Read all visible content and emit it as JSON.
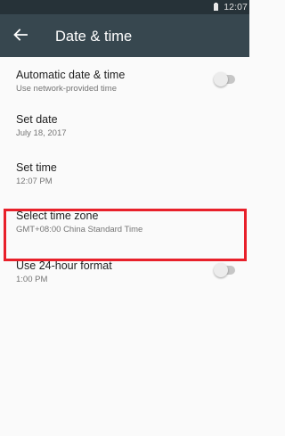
{
  "status_bar": {
    "time": "12:07"
  },
  "app_bar": {
    "back_icon": "arrow-left-icon",
    "title": "Date & time"
  },
  "settings": [
    {
      "title": "Automatic date & time",
      "summary": "Use network-provided time",
      "toggle": {
        "on": false
      }
    },
    {
      "title": "Set date",
      "summary": "July 18, 2017"
    },
    {
      "title": "Set time",
      "summary": "12:07 PM"
    },
    {
      "title": "Select time zone",
      "summary": "GMT+08:00 China Standard Time",
      "highlighted": true
    },
    {
      "title": "Use 24-hour format",
      "summary": "1:00 PM",
      "toggle": {
        "on": false
      }
    }
  ],
  "colors": {
    "status_bar": "#263238",
    "app_bar": "#37474f",
    "background": "#fafafa",
    "highlight_border": "#e8202a",
    "primary_text": "#212121",
    "secondary_text": "#757575"
  }
}
